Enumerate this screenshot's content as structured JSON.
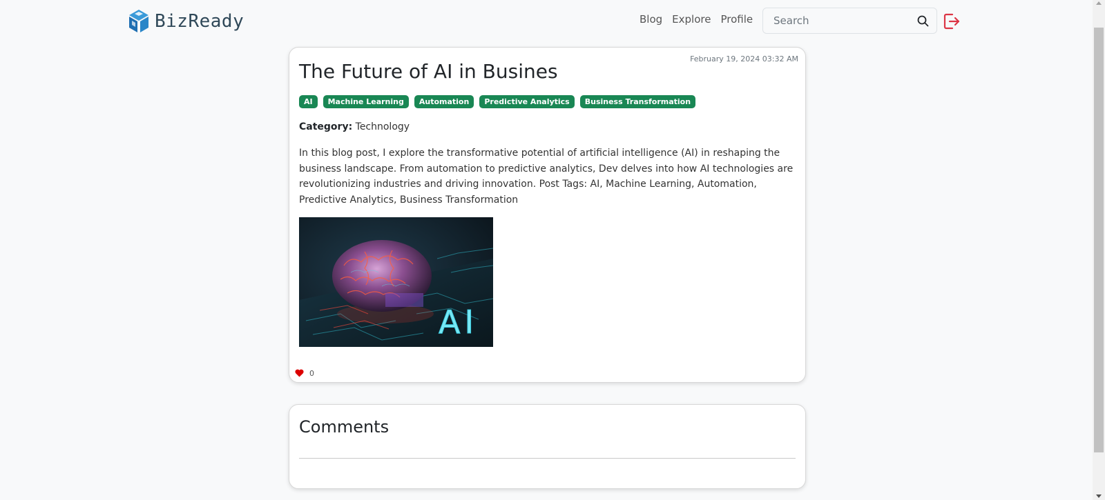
{
  "navbar": {
    "brand_name": "BizReady",
    "links": [
      "Blog",
      "Explore",
      "Profile"
    ],
    "search_placeholder": "Search",
    "icons": {
      "logo": "cube-logo-icon",
      "search": "search-icon",
      "logout": "logout-icon"
    },
    "logout_color": "#dc3545"
  },
  "post": {
    "date": "February 19, 2024 03:32 AM",
    "title": "The Future of AI in Busines",
    "tags": [
      "AI",
      "Machine Learning",
      "Automation",
      "Predictive Analytics",
      "Business Transformation"
    ],
    "category_label": "Category:",
    "category_value": "Technology",
    "body": "In this blog post, I explore the transformative potential of artificial intelligence (AI) in reshaping the business landscape. From automation to predictive analytics, Dev delves into how AI technologies are revolutionizing industries and driving innovation. Post Tags: AI, Machine Learning, Automation, Predictive Analytics, Business Transformation",
    "image_text": "AI",
    "likes": "0",
    "tag_color": "#198754",
    "heart_color": "#dc0000"
  },
  "comments": {
    "title": "Comments"
  }
}
